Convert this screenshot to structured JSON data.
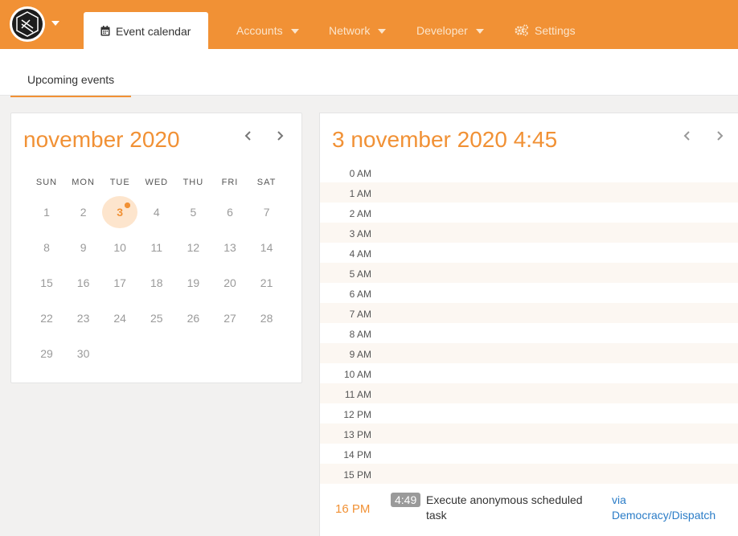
{
  "nav": {
    "logo_icon": "hexagon-logo-icon",
    "items": [
      {
        "label": "Event calendar",
        "icon": "calendar-icon",
        "active": true
      },
      {
        "label": "Accounts",
        "dropdown": true
      },
      {
        "label": "Network",
        "dropdown": true
      },
      {
        "label": "Developer",
        "dropdown": true
      },
      {
        "label": "Settings",
        "icon": "gears-icon"
      }
    ]
  },
  "subtabs": [
    {
      "label": "Upcoming events",
      "active": true
    }
  ],
  "month_calendar": {
    "title": "november 2020",
    "weekdays": [
      "SUN",
      "MON",
      "TUE",
      "WED",
      "THU",
      "FRI",
      "SAT"
    ],
    "weeks": [
      [
        "1",
        "2",
        "3",
        "4",
        "5",
        "6",
        "7"
      ],
      [
        "8",
        "9",
        "10",
        "11",
        "12",
        "13",
        "14"
      ],
      [
        "15",
        "16",
        "17",
        "18",
        "19",
        "20",
        "21"
      ],
      [
        "22",
        "23",
        "24",
        "25",
        "26",
        "27",
        "28"
      ],
      [
        "29",
        "30",
        "",
        "",
        "",
        "",
        ""
      ]
    ],
    "selected_day": "3"
  },
  "day_view": {
    "title": "3 november 2020 4:45",
    "hours": [
      "0 AM",
      "1 AM",
      "2 AM",
      "3 AM",
      "4 AM",
      "5 AM",
      "6 AM",
      "7 AM",
      "8 AM",
      "9 AM",
      "10 AM",
      "11 AM",
      "12 PM",
      "13 PM",
      "14 PM",
      "15 PM"
    ],
    "event": {
      "hour_label": "16 PM",
      "time": "4:49",
      "title": "Execute anonymous scheduled task",
      "link": "via Democracy/Dispatch"
    }
  },
  "colors": {
    "accent": "#f19135",
    "link": "#2a7cc7"
  }
}
